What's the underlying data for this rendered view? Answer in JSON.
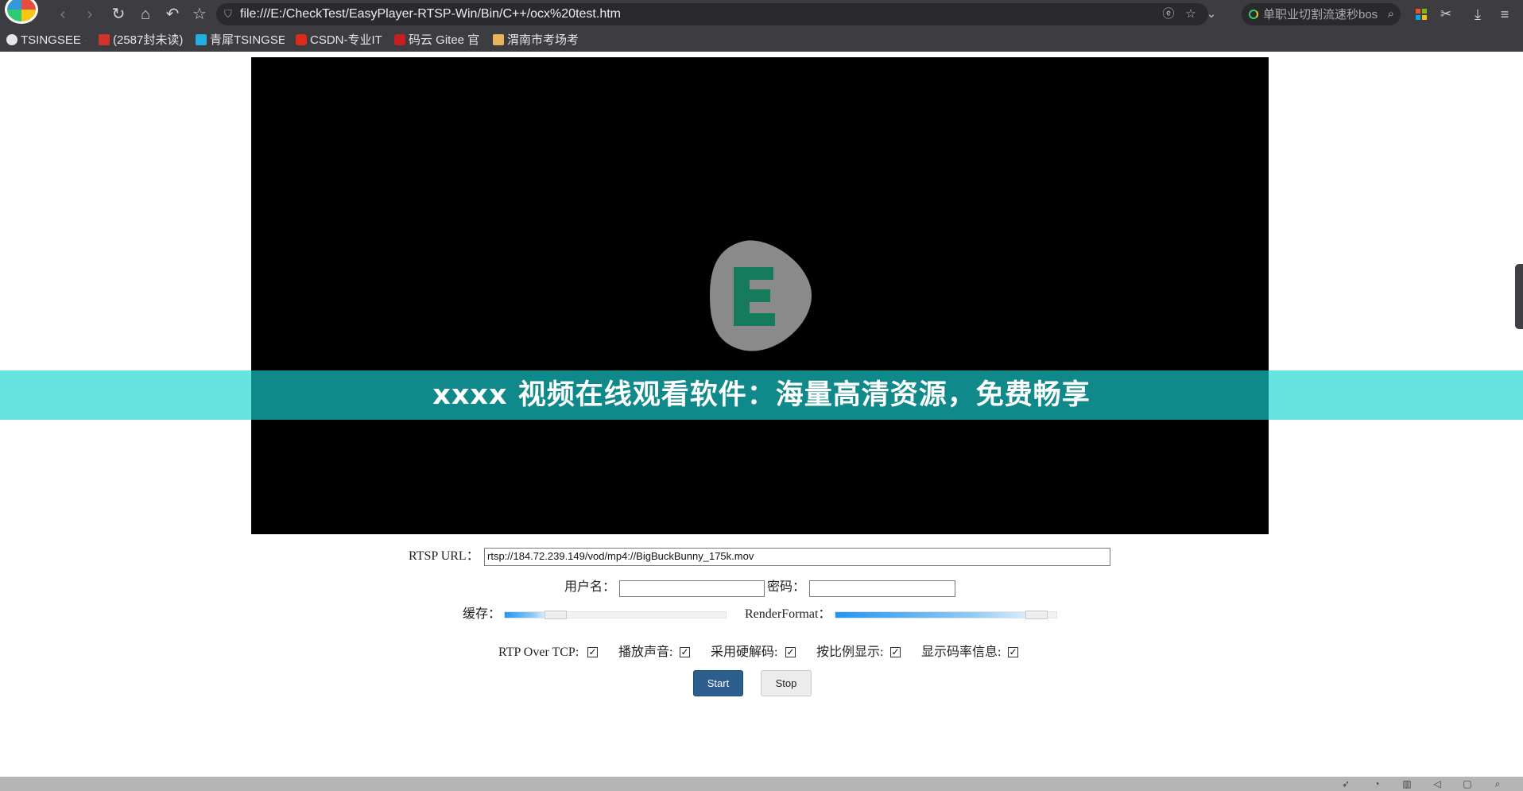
{
  "browser": {
    "url": "file:///E:/CheckTest/EasyPlayer-RTSP-Win/Bin/C++/ocx%20test.htm",
    "search_placeholder": "单职业切割流速秒bos",
    "bookmarks": [
      {
        "label": "TSINGSEE ·",
        "color": "#e6e6e6"
      },
      {
        "label": "(2587封未读)",
        "color": "#d0342c"
      },
      {
        "label": "青犀TSINGSE",
        "color": "#22aee0"
      },
      {
        "label": "CSDN-专业IT",
        "color": "#e0291c"
      },
      {
        "label": "码云 Gitee 官",
        "color": "#c71d23"
      },
      {
        "label": "渭南市考场考",
        "color": "#e6b45a"
      }
    ]
  },
  "player": {
    "banner_text": "xxxx 视频在线观看软件：海量高清资源，免费畅享",
    "logo_letter": "E",
    "banner_color": "#10898a",
    "banner_band_color": "#67e3e0"
  },
  "controls": {
    "rtsp_label": "RTSP URL：",
    "rtsp_value": "rtsp://184.72.239.149/vod/mp4://BigBuckBunny_175k.mov",
    "username_label": "用户名：",
    "username_value": "",
    "password_label": "密码：",
    "password_value": "",
    "buffer_label": "缓存：",
    "buffer_level": 0.2,
    "render_label": "RenderFormat：",
    "render_level": 0.88,
    "checkboxes": [
      {
        "label": "RTP Over TCP:",
        "checked": true
      },
      {
        "label": "播放声音:",
        "checked": true
      },
      {
        "label": "采用硬解码:",
        "checked": true
      },
      {
        "label": "按比例显示:",
        "checked": true
      },
      {
        "label": "显示码率信息:",
        "checked": true
      }
    ],
    "start_label": "Start",
    "stop_label": "Stop",
    "check_mark": "✓"
  }
}
